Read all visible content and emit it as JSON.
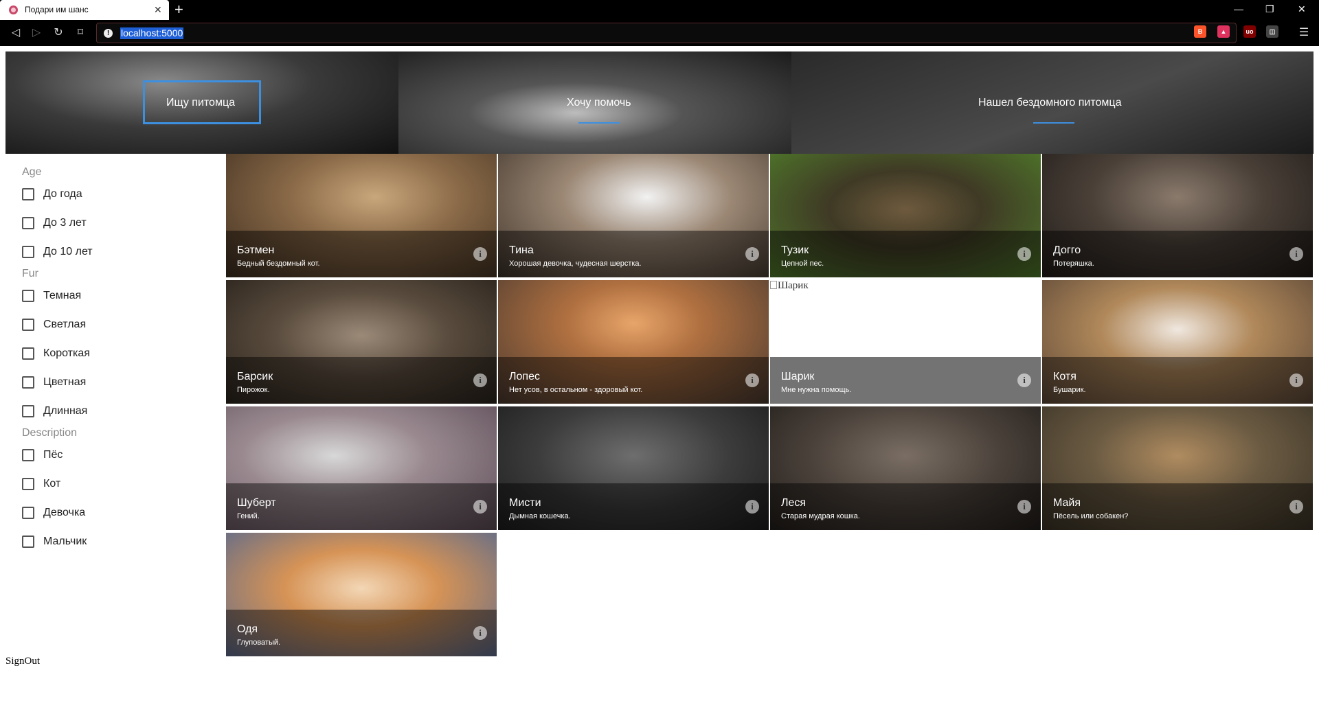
{
  "browser": {
    "tab_title": "Подари им шанс",
    "tab_close": "✕",
    "new_tab": "+",
    "url": "localhost:5000",
    "info_glyph": "!",
    "window_min": "—",
    "window_restore": "❐",
    "window_close": "✕",
    "menu_glyph": "☰",
    "back_glyph": "◁",
    "forward_glyph": "▷",
    "reload_glyph": "↻",
    "bookmark_glyph": "⌑",
    "extensions": [
      {
        "name": "brave-shield-icon",
        "color": "#fb542b",
        "glyph": "B"
      },
      {
        "name": "brave-rewards-icon",
        "color": "#e0325f",
        "glyph": "▲"
      },
      {
        "name": "ublock-icon",
        "color": "#800000",
        "glyph": "uo"
      },
      {
        "name": "reader-icon",
        "color": "#444444",
        "glyph": "◫"
      }
    ],
    "rewards_badge": "1"
  },
  "hero": [
    {
      "label": "Ищу питомца",
      "selected": true
    },
    {
      "label": "Хочу помочь",
      "selected": false
    },
    {
      "label": "Нашел бездомного питомца",
      "selected": false
    }
  ],
  "filters": [
    {
      "heading": "Age",
      "options": [
        "До года",
        "До 3 лет",
        "До 10 лет"
      ]
    },
    {
      "heading": "Fur",
      "options": [
        "Темная",
        "Светлая",
        "Короткая",
        "Цветная",
        "Длинная"
      ]
    },
    {
      "heading": "Description",
      "options": [
        "Пёс",
        "Кот",
        "Девочка",
        "Мальчик"
      ]
    }
  ],
  "pets": [
    {
      "name": "Бэтмен",
      "desc": "Бедный бездомный кот.",
      "kind": "cat"
    },
    {
      "name": "Тина",
      "desc": "Хорошая девочка, чудесная шерстка.",
      "kind": "dog"
    },
    {
      "name": "Тузик",
      "desc": "Цепной пес.",
      "kind": "dog"
    },
    {
      "name": "Догго",
      "desc": "Потеряшка.",
      "kind": "dog"
    },
    {
      "name": "Барсик",
      "desc": "Пирожок.",
      "kind": "cat"
    },
    {
      "name": "Лопес",
      "desc": "Нет усов, в остальном - здоровый кот.",
      "kind": "cat"
    },
    {
      "name": "Шарик",
      "desc": "Мне нужна помощь.",
      "kind": "broken",
      "alt": "Шарик"
    },
    {
      "name": "Котя",
      "desc": "Бушарик.",
      "kind": "cat"
    },
    {
      "name": "Шуберт",
      "desc": "Гений.",
      "kind": "cat"
    },
    {
      "name": "Мисти",
      "desc": "Дымная кошечка.",
      "kind": "cat"
    },
    {
      "name": "Леся",
      "desc": "Старая мудрая кошка.",
      "kind": "cat"
    },
    {
      "name": "Майя",
      "desc": "Пёсель или собакен?",
      "kind": "dog"
    },
    {
      "name": "Одя",
      "desc": "Глуповатый.",
      "kind": "cat"
    }
  ],
  "info_glyph": "i",
  "signout": "SignOut",
  "colors": {
    "accent": "#3d8fe0",
    "browser_bg": "#000000"
  }
}
